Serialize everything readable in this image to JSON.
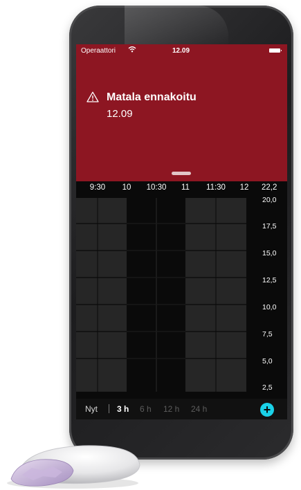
{
  "status_bar": {
    "carrier": "Operaattori",
    "time": "12.09"
  },
  "alert": {
    "title": "Matala ennakoitu",
    "time": "12.09"
  },
  "chart": {
    "x_ticks": [
      "9:30",
      "10",
      "10:30",
      "11",
      "11:30",
      "12"
    ],
    "top_value": "22,2",
    "y_ticks": [
      "20,0",
      "17,5",
      "15,0",
      "12,5",
      "10,0",
      "7,5",
      "5,0",
      "2,5"
    ]
  },
  "range_selector": {
    "now_label": "Nyt",
    "options": [
      "3 h",
      "6 h",
      "12 h",
      "24 h"
    ],
    "selected": "3 h",
    "add_symbol": "+"
  },
  "colors": {
    "alert_red": "#8d1622",
    "accent_cyan": "#1ad1e8",
    "chart_cell": "#262626",
    "background": "#0a0a0a"
  },
  "icons": [
    "wifi-icon",
    "battery-icon",
    "warning-icon",
    "plus-icon"
  ]
}
